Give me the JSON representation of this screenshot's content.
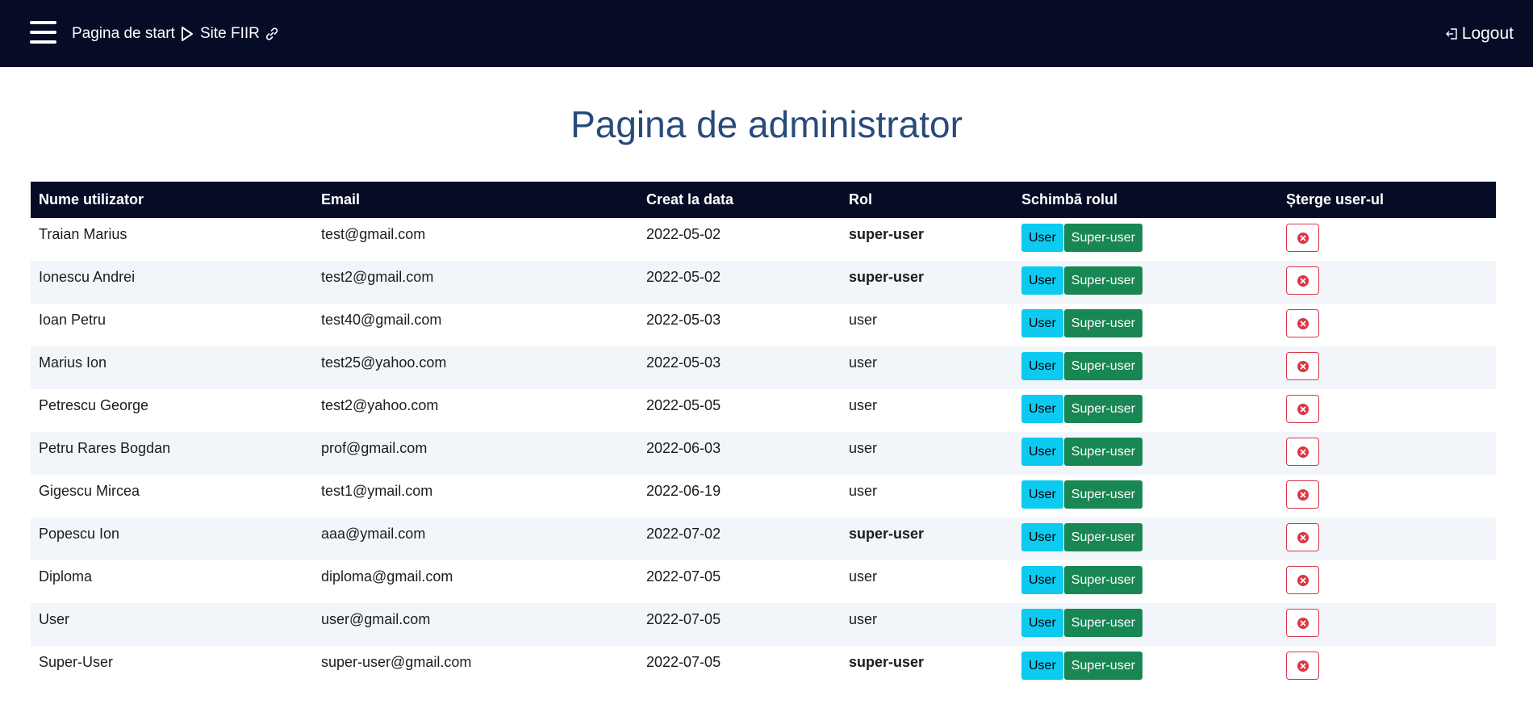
{
  "nav": {
    "start_label": "Pagina de start",
    "site_label": "Site FIIR",
    "logout_label": "Logout"
  },
  "page": {
    "title": "Pagina de administrator"
  },
  "table": {
    "headers": [
      "Nume utilizator",
      "Email",
      "Creat la data",
      "Rol",
      "Schimbă rolul",
      "Șterge user-ul"
    ],
    "buttons": {
      "user": "User",
      "super_user": "Super-user"
    },
    "rows": [
      {
        "name": "Traian Marius",
        "email": "test@gmail.com",
        "created": "2022-05-02",
        "role": "super-user"
      },
      {
        "name": "Ionescu Andrei",
        "email": "test2@gmail.com",
        "created": "2022-05-02",
        "role": "super-user"
      },
      {
        "name": "Ioan Petru",
        "email": "test40@gmail.com",
        "created": "2022-05-03",
        "role": "user"
      },
      {
        "name": "Marius Ion",
        "email": "test25@yahoo.com",
        "created": "2022-05-03",
        "role": "user"
      },
      {
        "name": "Petrescu George",
        "email": "test2@yahoo.com",
        "created": "2022-05-05",
        "role": "user"
      },
      {
        "name": "Petru Rares Bogdan",
        "email": "prof@gmail.com",
        "created": "2022-06-03",
        "role": "user"
      },
      {
        "name": "Gigescu Mircea",
        "email": "test1@ymail.com",
        "created": "2022-06-19",
        "role": "user"
      },
      {
        "name": "Popescu Ion",
        "email": "aaa@ymail.com",
        "created": "2022-07-02",
        "role": "super-user"
      },
      {
        "name": "Diploma",
        "email": "diploma@gmail.com",
        "created": "2022-07-05",
        "role": "user"
      },
      {
        "name": "User",
        "email": "user@gmail.com",
        "created": "2022-07-05",
        "role": "user"
      },
      {
        "name": "Super-User",
        "email": "super-user@gmail.com",
        "created": "2022-07-05",
        "role": "super-user"
      }
    ]
  },
  "colors": {
    "navbar": "#070c26",
    "title": "#2a4a7c",
    "btn_user": "#0dcaf0",
    "btn_super": "#198754",
    "btn_delete": "#dc3545"
  }
}
